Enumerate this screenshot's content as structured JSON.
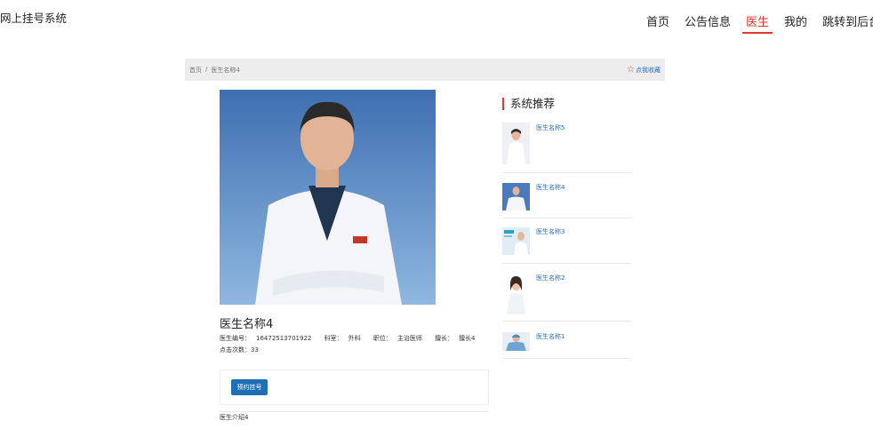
{
  "header": {
    "site_title": "网上挂号系统",
    "nav": [
      {
        "label": "首页",
        "active": false
      },
      {
        "label": "公告信息",
        "active": false
      },
      {
        "label": "医生",
        "active": true
      },
      {
        "label": "我的",
        "active": false
      },
      {
        "label": "跳转到后台",
        "active": false
      }
    ]
  },
  "breadcrumb": {
    "home": "首页",
    "separator": "/",
    "current": "医生名称4",
    "favorite_icon": "star-outline-icon",
    "favorite_label": "点我收藏"
  },
  "doctor": {
    "name": "医生名称4",
    "id_label": "医生编号：",
    "id_value": "16472513701922",
    "dept_label": "科室：",
    "dept_value": "外科",
    "title_label": "职位：",
    "title_value": "主治医师",
    "specialty_label": "擅长：",
    "specialty_value": "擅长4",
    "clicks_label": "点击次数：",
    "clicks_value": "33",
    "book_button": "预约挂号",
    "intro": "医生介绍4"
  },
  "recommend": {
    "title": "系统推荐",
    "items": [
      {
        "name": "医生名称5"
      },
      {
        "name": "医生名称4"
      },
      {
        "name": "医生名称3"
      },
      {
        "name": "医生名称2"
      },
      {
        "name": "医生名称1"
      }
    ]
  },
  "colors": {
    "accent_red": "#e03a2e",
    "link_blue": "#2a6fbf",
    "button_blue": "#1e6fb3",
    "bar_gray": "#ededed"
  }
}
